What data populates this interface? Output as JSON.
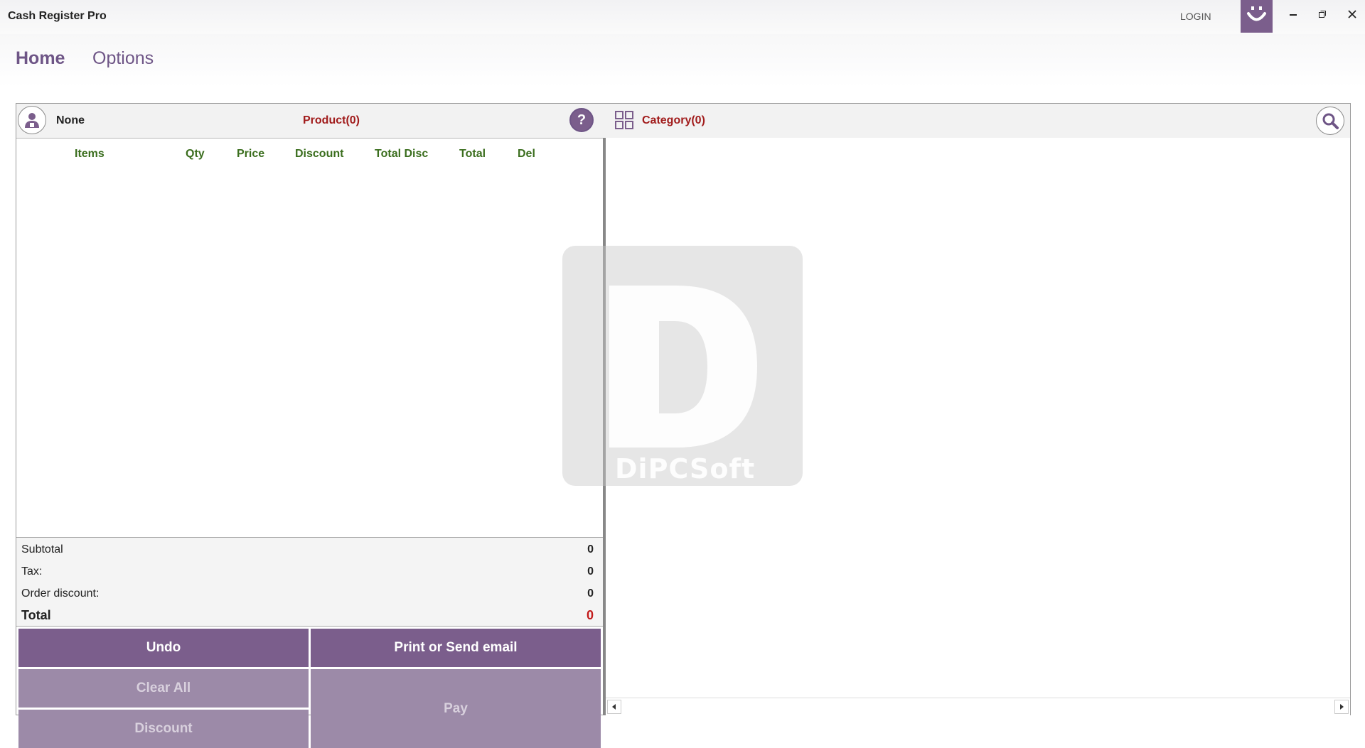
{
  "app": {
    "title": "Cash Register Pro",
    "login_label": "LOGIN",
    "accent_color": "#7b5e8c"
  },
  "window_controls": {
    "minimize_icon": "minimize-icon",
    "restore_icon": "restore-icon",
    "close_icon": "close-icon"
  },
  "nav": {
    "tabs": [
      {
        "label": "Home",
        "active": true
      },
      {
        "label": "Options",
        "active": false
      }
    ]
  },
  "customer": {
    "name": "None",
    "icon": "user-icon"
  },
  "product_count_label": "Product(0)",
  "category_count_label": "Category(0)",
  "grid": {
    "columns": [
      "Items",
      "Qty",
      "Price",
      "Discount",
      "Total Disc",
      "Total",
      "Del"
    ],
    "rows": []
  },
  "totals": {
    "subtotal_label": "Subtotal",
    "subtotal_value": "0",
    "tax_label": "Tax:",
    "tax_value": "0",
    "order_discount_label": "Order discount:",
    "order_discount_value": "0",
    "total_label": "Total",
    "total_value": "0"
  },
  "actions": {
    "undo": "Undo",
    "print_email": "Print or Send email",
    "clear_all": "Clear All",
    "discount": "Discount",
    "pay": "Pay"
  },
  "watermark": {
    "letter": "D",
    "brand": "DiPCSoft"
  }
}
